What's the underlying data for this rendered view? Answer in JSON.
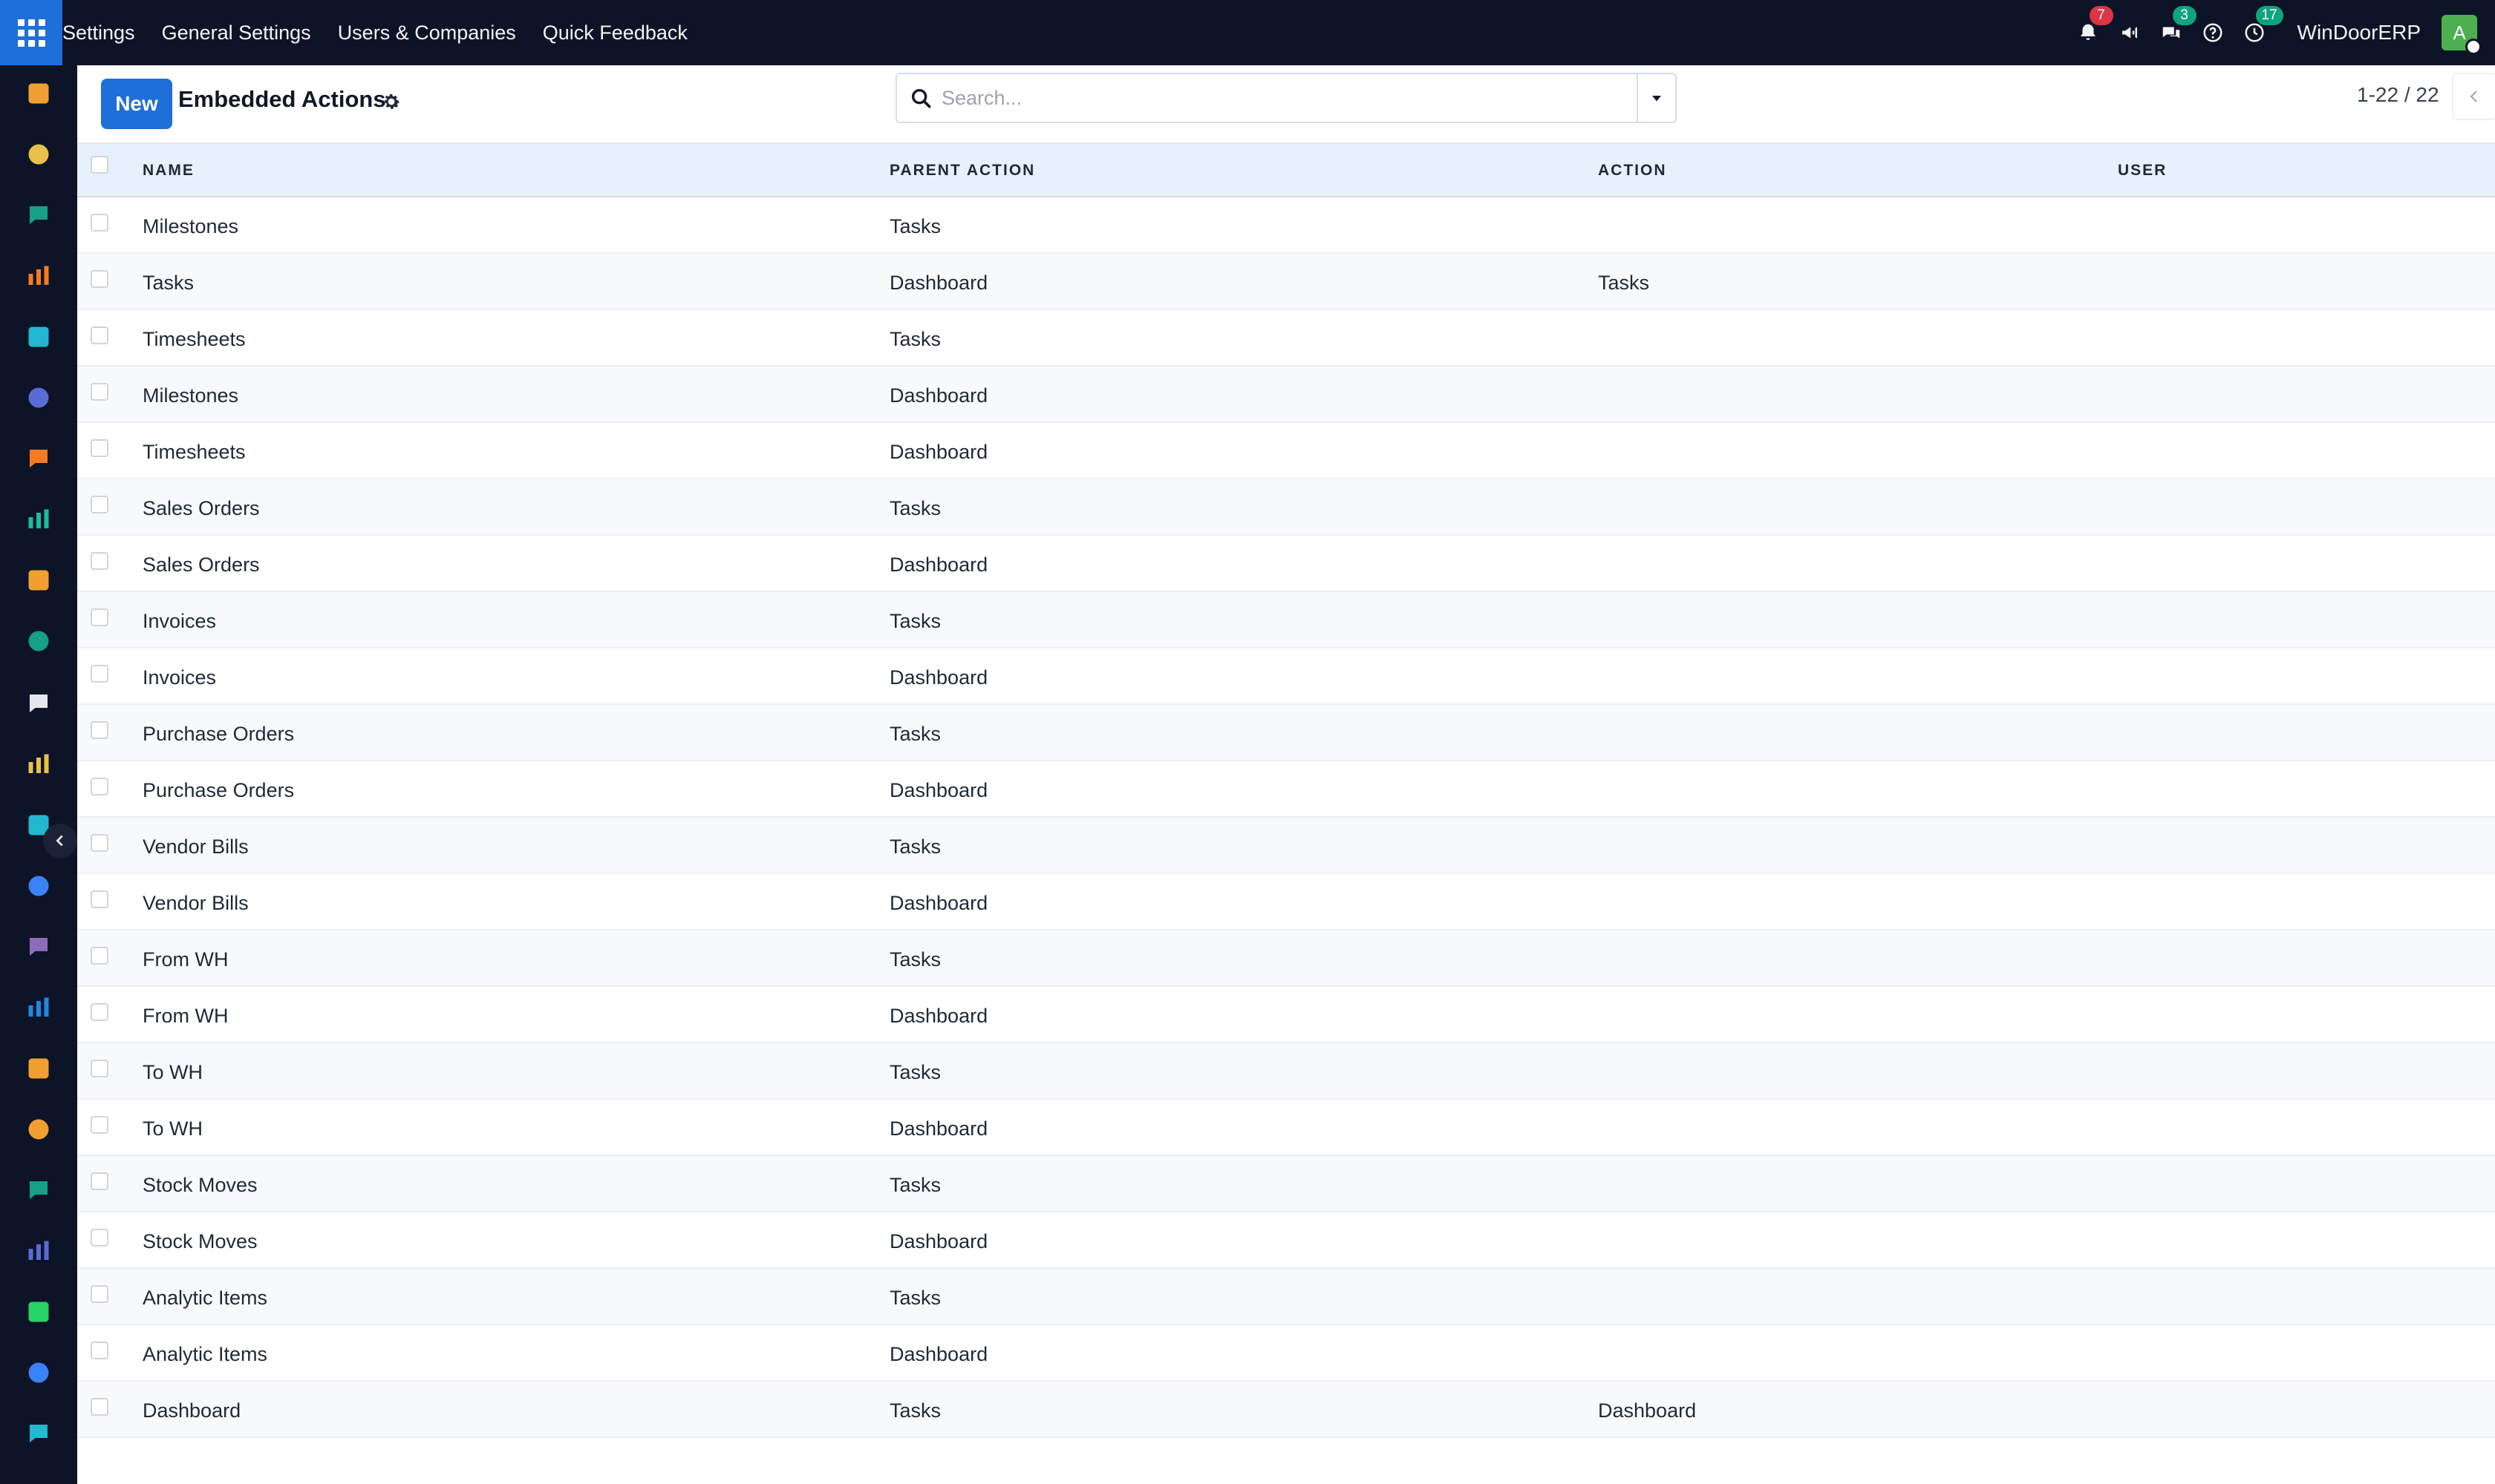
{
  "topbar": {
    "menu": [
      "Settings",
      "General Settings",
      "Users & Companies",
      "Quick Feedback"
    ],
    "notifications_count": "7",
    "messages_count": "3",
    "activities_count": "17",
    "company": "WinDoorERP",
    "avatar_initial": "A",
    "icons": [
      "apps-grid-icon",
      "bell-icon",
      "megaphone-icon",
      "chat-icon",
      "help-icon",
      "clock-icon"
    ]
  },
  "control": {
    "new_label": "New",
    "title": "Embedded Actions",
    "search_placeholder": "Search...",
    "pager": "1-22 / 22"
  },
  "table": {
    "columns": {
      "name": "NAME",
      "parent_action": "PARENT ACTION",
      "action": "ACTION",
      "user": "USER"
    },
    "rows": [
      {
        "name": "Milestones",
        "parent": "Tasks",
        "action": "",
        "user": ""
      },
      {
        "name": "Tasks",
        "parent": "Dashboard",
        "action": "Tasks",
        "user": ""
      },
      {
        "name": "Timesheets",
        "parent": "Tasks",
        "action": "",
        "user": ""
      },
      {
        "name": "Milestones",
        "parent": "Dashboard",
        "action": "",
        "user": ""
      },
      {
        "name": "Timesheets",
        "parent": "Dashboard",
        "action": "",
        "user": ""
      },
      {
        "name": "Sales Orders",
        "parent": "Tasks",
        "action": "",
        "user": ""
      },
      {
        "name": "Sales Orders",
        "parent": "Dashboard",
        "action": "",
        "user": ""
      },
      {
        "name": "Invoices",
        "parent": "Tasks",
        "action": "",
        "user": ""
      },
      {
        "name": "Invoices",
        "parent": "Dashboard",
        "action": "",
        "user": ""
      },
      {
        "name": "Purchase Orders",
        "parent": "Tasks",
        "action": "",
        "user": ""
      },
      {
        "name": "Purchase Orders",
        "parent": "Dashboard",
        "action": "",
        "user": ""
      },
      {
        "name": "Vendor Bills",
        "parent": "Tasks",
        "action": "",
        "user": ""
      },
      {
        "name": "Vendor Bills",
        "parent": "Dashboard",
        "action": "",
        "user": ""
      },
      {
        "name": "From WH",
        "parent": "Tasks",
        "action": "",
        "user": ""
      },
      {
        "name": "From WH",
        "parent": "Dashboard",
        "action": "",
        "user": ""
      },
      {
        "name": "To WH",
        "parent": "Tasks",
        "action": "",
        "user": ""
      },
      {
        "name": "To WH",
        "parent": "Dashboard",
        "action": "",
        "user": ""
      },
      {
        "name": "Stock Moves",
        "parent": "Tasks",
        "action": "",
        "user": ""
      },
      {
        "name": "Stock Moves",
        "parent": "Dashboard",
        "action": "",
        "user": ""
      },
      {
        "name": "Analytic Items",
        "parent": "Tasks",
        "action": "",
        "user": ""
      },
      {
        "name": "Analytic Items",
        "parent": "Dashboard",
        "action": "",
        "user": ""
      },
      {
        "name": "Dashboard",
        "parent": "Tasks",
        "action": "Dashboard",
        "user": ""
      }
    ]
  },
  "rail": {
    "apps": [
      {
        "icon": "sales-app-icon",
        "color": "#f0a030"
      },
      {
        "icon": "inventory-app-icon",
        "color": "#e7c14a"
      },
      {
        "icon": "contacts-app-icon",
        "color": "#16a085"
      },
      {
        "icon": "discuss-app-icon",
        "color": "#f27c21"
      },
      {
        "icon": "website-app-icon",
        "color": "#22b8cf"
      },
      {
        "icon": "email-marketing-app-icon",
        "color": "#5a6bd6"
      },
      {
        "icon": "livechat-app-icon",
        "color": "#f27c21"
      },
      {
        "icon": "crm-app-icon",
        "color": "#1abc9c"
      },
      {
        "icon": "accounting-app-icon",
        "color": "#f0a030"
      },
      {
        "icon": "employees-app-icon",
        "color": "#16a085"
      },
      {
        "icon": "modules-app-icon",
        "color": "#e5e7eb"
      },
      {
        "icon": "point-of-sale-app-icon",
        "color": "#e7c14a"
      },
      {
        "icon": "project-app-icon",
        "color": "#22b8cf"
      },
      {
        "icon": "knowledge-app-icon",
        "color": "#3b82f6"
      },
      {
        "icon": "purchase-app-icon",
        "color": "#8e6bb8"
      },
      {
        "icon": "invoicing-app-icon",
        "color": "#1e88e5"
      },
      {
        "icon": "team-app-icon",
        "color": "#f0a030"
      },
      {
        "icon": "calendar-app-icon",
        "color": "#f0a030"
      },
      {
        "icon": "sign-app-icon",
        "color": "#16a085"
      },
      {
        "icon": "dashboards-app-icon",
        "color": "#5a6bd6"
      },
      {
        "icon": "whatsapp-app-icon",
        "color": "#25d366"
      },
      {
        "icon": "timesheet-app-icon",
        "color": "#3b82f6"
      },
      {
        "icon": "website-builder-app-icon",
        "color": "#22b8cf"
      }
    ]
  }
}
